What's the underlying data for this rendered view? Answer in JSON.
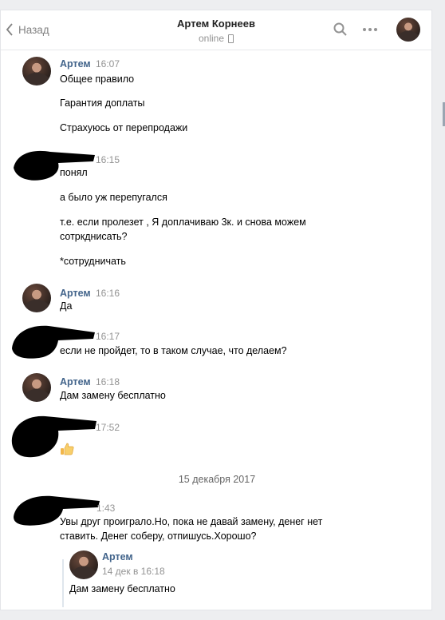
{
  "header": {
    "back_label": "Назад",
    "title": "Артем Корнеев",
    "status": "online"
  },
  "messages": [
    {
      "author": "Артем",
      "time": "16:07",
      "lines": [
        "Общее правило",
        "Гарантия доплаты",
        "Страхуюсь от перепродажи"
      ]
    },
    {
      "author": "",
      "time": "16:15",
      "lines": [
        "понял",
        "а было уж перепугался",
        "т.е. если пролезет , Я доплачиваю 3к. и снова можем сотркднисать?",
        "*сотрудничать"
      ]
    },
    {
      "author": "Артем",
      "time": "16:16",
      "lines": [
        "Да"
      ]
    },
    {
      "author": "",
      "time": "16:17",
      "lines": [
        "если не пройдет, то в таком случае, что делаем?"
      ]
    },
    {
      "author": "Артем",
      "time": "16:18",
      "lines": [
        "Дам замену бесплатно"
      ]
    },
    {
      "author": "",
      "time": "17:52",
      "emoji": "thumbs-up"
    }
  ],
  "date_separator": "15 декабря 2017",
  "last_message": {
    "time": "1:43",
    "text": "Увы друг проиграло.Но, пока не давай замену, денег нет ставить. Денег соберу, отпишусь.Хорошо?",
    "forwarded": {
      "author": "Артем",
      "date": "14 дек в 16:18",
      "text": "Дам замену бесплатно"
    }
  },
  "icons": [
    "chevron-left-icon",
    "search-icon",
    "more-icon",
    "phone-icon",
    "thumbs-up-icon"
  ]
}
